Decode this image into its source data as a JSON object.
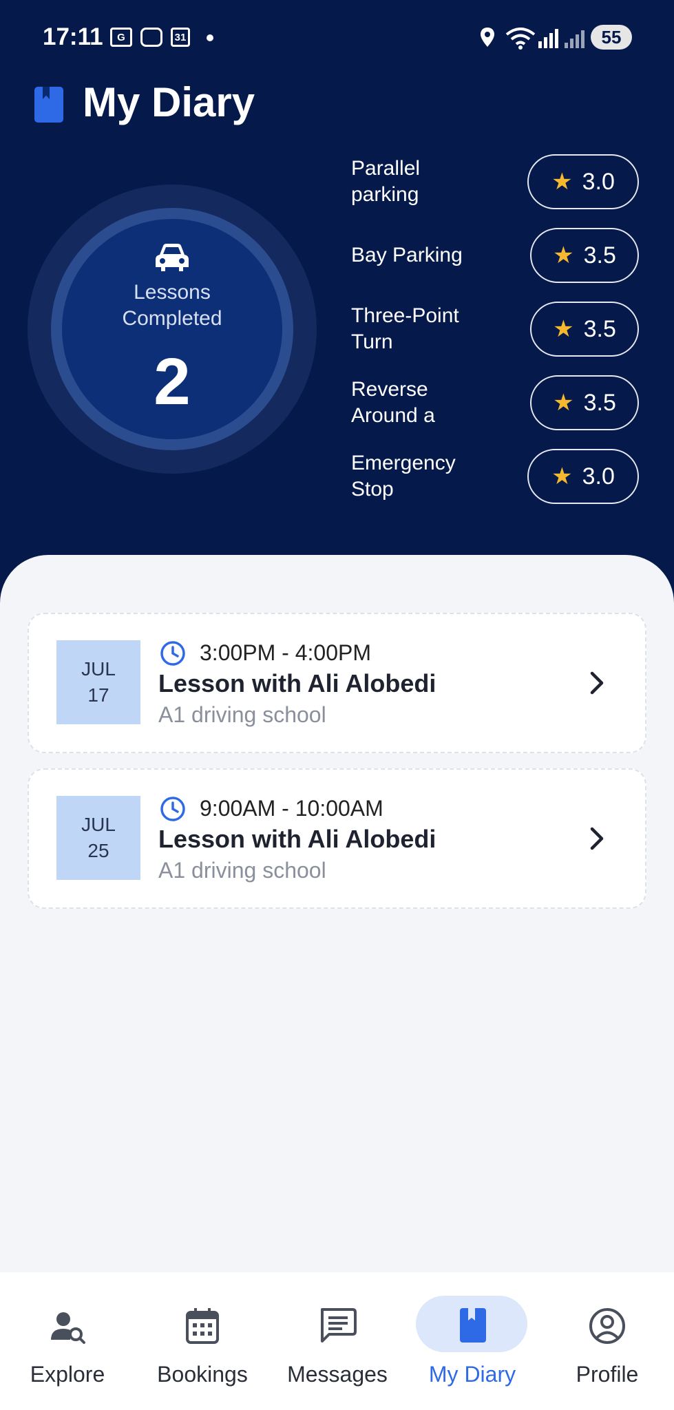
{
  "status_bar": {
    "time": "17:11",
    "battery": "55",
    "icons": [
      "gallery-icon",
      "screenshot-icon",
      "calendar-icon",
      "location-icon",
      "wifi-icon",
      "signal-icon"
    ]
  },
  "header": {
    "title": "My Diary",
    "title_icon": "diary-icon"
  },
  "summary": {
    "label_line1": "Lessons",
    "label_line2": "Completed",
    "count": "2",
    "icon": "car-icon"
  },
  "skills": [
    {
      "name": "Parallel parking",
      "rating": "3.0"
    },
    {
      "name": "Bay Parking",
      "rating": "3.5"
    },
    {
      "name": "Three-Point Turn",
      "rating": "3.5"
    },
    {
      "name": "Reverse Around a",
      "rating": "3.5"
    },
    {
      "name": "Emergency Stop",
      "rating": "3.0"
    }
  ],
  "lessons": [
    {
      "month": "JUL",
      "day": "17",
      "time": "3:00PM - 4:00PM",
      "title": "Lesson with Ali Alobedi",
      "school": "A1 driving school"
    },
    {
      "month": "JUL",
      "day": "25",
      "time": "9:00AM - 10:00AM",
      "title": "Lesson with Ali Alobedi",
      "school": "A1 driving school"
    }
  ],
  "nav": [
    {
      "label": "Explore",
      "icon": "explore-icon",
      "active": false
    },
    {
      "label": "Bookings",
      "icon": "calendar-icon",
      "active": false
    },
    {
      "label": "Messages",
      "icon": "messages-icon",
      "active": false
    },
    {
      "label": "My Diary",
      "icon": "diary-icon",
      "active": true
    },
    {
      "label": "Profile",
      "icon": "profile-icon",
      "active": false
    }
  ],
  "colors": {
    "header_bg": "#051a4a",
    "accent": "#2e6ae6",
    "star": "#f5b82e",
    "date_box": "#bfd6f7",
    "content_bg": "#f4f5f9"
  }
}
